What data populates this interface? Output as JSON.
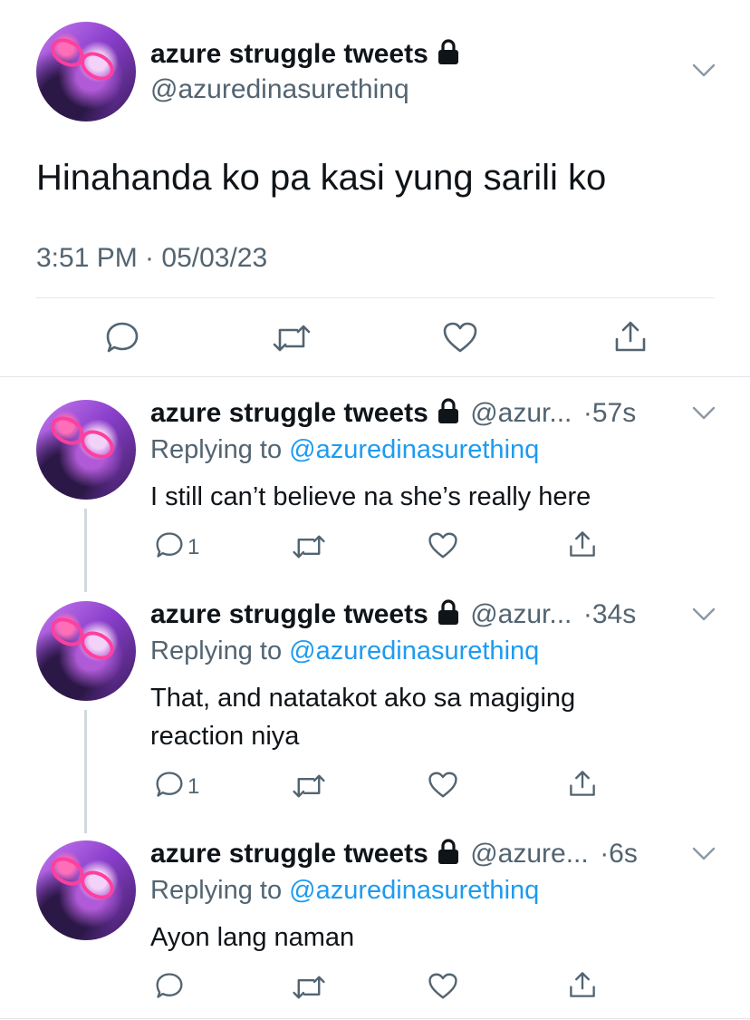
{
  "main_tweet": {
    "name": "azure struggle tweets",
    "handle": "@azuredinasurethinq",
    "text": "Hinahanda ko pa kasi yung sarili ko",
    "timestamp": "3:51 PM · 05/03/23"
  },
  "replies": [
    {
      "name": "azure struggle tweets",
      "handle_truncated": "@azur...",
      "time": "·57s",
      "replying_prefix": "Replying to",
      "replying_to": "@azuredinasurethinq",
      "text_lines": [
        "I still can’t believe na she’s really here"
      ],
      "reply_count": "1"
    },
    {
      "name": "azure struggle tweets",
      "handle_truncated": "@azur...",
      "time": "·34s",
      "replying_prefix": "Replying to",
      "replying_to": "@azuredinasurethinq",
      "text_lines": [
        "That, and natatakot ako sa magiging",
        "reaction niya"
      ],
      "reply_count": "1"
    },
    {
      "name": "azure struggle tweets",
      "handle_truncated": "@azure...",
      "time": "·6s",
      "replying_prefix": "Replying to",
      "replying_to": "@azuredinasurethinq",
      "text_lines": [
        "Ayon lang naman"
      ],
      "reply_count": ""
    }
  ],
  "icons": {
    "reply": "speech-bubble-icon",
    "retweet": "retweet-icon",
    "like": "heart-icon",
    "share": "share-icon",
    "lock": "lock-icon",
    "more": "chevron-down-icon"
  },
  "colors": {
    "link": "#1d9bf0",
    "secondary_text": "#536471",
    "text": "#0f1419"
  }
}
